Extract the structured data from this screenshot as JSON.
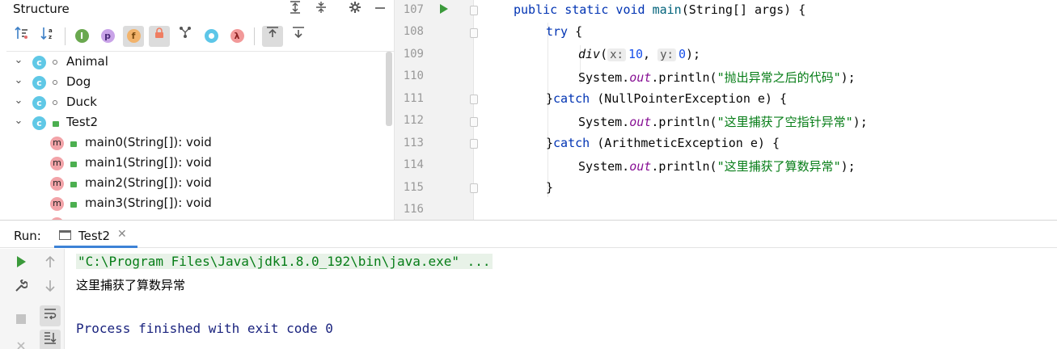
{
  "structure": {
    "title": "Structure",
    "toolbar": {
      "p_label": "p",
      "f_label": "f",
      "lambda_label": "λ"
    },
    "classes": [
      {
        "name": "Animal",
        "icon_letter": "c"
      },
      {
        "name": "Dog",
        "icon_letter": "c"
      },
      {
        "name": "Duck",
        "icon_letter": "c"
      },
      {
        "name": "Test2",
        "icon_letter": "c"
      }
    ],
    "methods": [
      {
        "name": "main0(String[]): void",
        "icon_letter": "m"
      },
      {
        "name": "main1(String[]): void",
        "icon_letter": "m"
      },
      {
        "name": "main2(String[]): void",
        "icon_letter": "m"
      },
      {
        "name": "main3(String[]): void",
        "icon_letter": "m"
      }
    ]
  },
  "editor": {
    "line_numbers": [
      "107",
      "108",
      "109",
      "110",
      "111",
      "112",
      "113",
      "114",
      "115",
      "116"
    ],
    "code": {
      "l107": {
        "kw1": "public static void ",
        "name": "main",
        "rest": "(String[] args) {"
      },
      "l108": {
        "kw": "try",
        "rest": " {"
      },
      "l109": {
        "call": "div",
        "open": "(",
        "hint_x": "x:",
        "x_val": "10",
        "comma": ",",
        "hint_y": "y:",
        "y_val": "0",
        "close": ");"
      },
      "l110": {
        "pre": "System.",
        "out": "out",
        "mid": ".println(",
        "str": "\"抛出异常之后的代码\"",
        "end": ");"
      },
      "l111": {
        "brace": "}",
        "kw": "catch",
        "rest": " (NullPointerException e) {"
      },
      "l112": {
        "pre": "System.",
        "out": "out",
        "mid": ".println(",
        "str": "\"这里捕获了空指针异常\"",
        "end": ");"
      },
      "l113": {
        "brace": "}",
        "kw": "catch",
        "rest": " (ArithmeticException e) {"
      },
      "l114": {
        "pre": "System.",
        "out": "out",
        "mid": ".println(",
        "str": "\"这里捕获了算数异常\"",
        "end": ");"
      },
      "l115": {
        "text": "}"
      }
    }
  },
  "run": {
    "title": "Run:",
    "tab_label": "Test2",
    "output": {
      "command": "\"C:\\Program Files\\Java\\jdk1.8.0_192\\bin\\java.exe\" ...",
      "line1": "这里捕获了算数异常",
      "finished": "Process finished with exit code 0"
    }
  },
  "colors": {
    "keyword": "#0033b3",
    "string": "#067d17",
    "number": "#1750eb",
    "static_field": "#871094",
    "run_green": "#3b9a3b",
    "command_bg": "#e8f2e8",
    "process_finished": "#1a237e",
    "class_icon": "#60c8e6",
    "method_icon": "#f2a3a8",
    "tab_underline": "#3d82d6"
  }
}
